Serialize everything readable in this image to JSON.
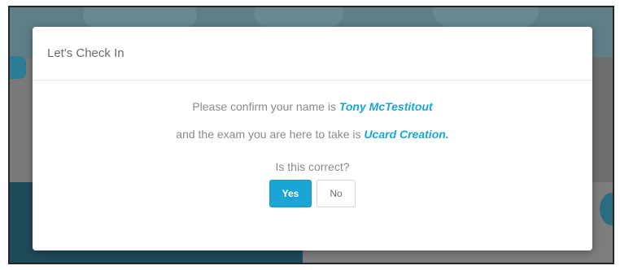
{
  "modal": {
    "title": "Let's Check In",
    "line1_prefix": "Please confirm your name is",
    "name": "Tony McTestitout",
    "line2_prefix": "and the exam you are here to take is",
    "exam": "Ucard Creation.",
    "question": "Is this correct?",
    "yes_label": "Yes",
    "no_label": "No"
  },
  "colors": {
    "accent": "#1ba5d4",
    "text_muted": "#8a8a8a",
    "title_text": "#6b6b6b",
    "overlay_dark": "#3a3a3a"
  }
}
